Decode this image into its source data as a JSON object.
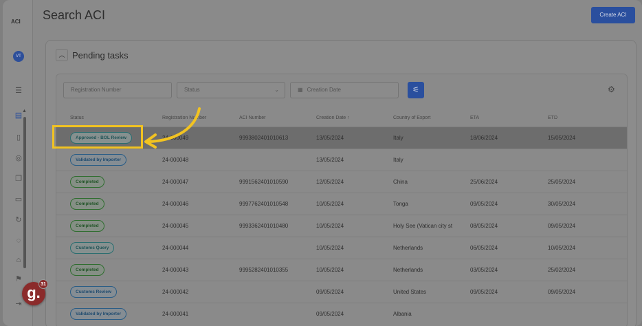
{
  "sidebar": {
    "logo": "ACI",
    "avatar_initials": "VT",
    "icons": [
      "filter-icon",
      "document-icon",
      "file-icon",
      "globe-icon",
      "copy-icon",
      "report-icon",
      "refresh-icon",
      "chat-icon",
      "user-icon",
      "flag-icon",
      "logout-icon"
    ]
  },
  "header": {
    "title": "Search ACI",
    "create_label": "Create ACI"
  },
  "panel": {
    "title": "Pending tasks"
  },
  "filters": {
    "registration_placeholder": "Registration Number",
    "status_placeholder": "Status",
    "creation_date_placeholder": "Creation Date"
  },
  "table": {
    "columns": [
      "Status",
      "Registration Number",
      "ACI Number",
      "Creation Date ↑",
      "Country of Export",
      "ETA",
      "ETD"
    ],
    "rows": [
      {
        "status": "Approved - BOL Review",
        "tone": "teal",
        "reg": "24-000049",
        "aci": "9993802401010613",
        "created": "13/05/2024",
        "country": "Italy",
        "eta": "18/06/2024",
        "etd": "15/05/2024"
      },
      {
        "status": "Validated by Importer",
        "tone": "blue",
        "reg": "24-000048",
        "aci": "",
        "created": "13/05/2024",
        "country": "Italy",
        "eta": "",
        "etd": ""
      },
      {
        "status": "Completed",
        "tone": "green",
        "reg": "24-000047",
        "aci": "9991562401010590",
        "created": "12/05/2024",
        "country": "China",
        "eta": "25/06/2024",
        "etd": "25/05/2024"
      },
      {
        "status": "Completed",
        "tone": "green",
        "reg": "24-000046",
        "aci": "9997762401010548",
        "created": "10/05/2024",
        "country": "Tonga",
        "eta": "09/05/2024",
        "etd": "30/05/2024"
      },
      {
        "status": "Completed",
        "tone": "green",
        "reg": "24-000045",
        "aci": "9993362401010480",
        "created": "10/05/2024",
        "country": "Holy See (Vatican city st",
        "eta": "08/05/2024",
        "etd": "09/05/2024"
      },
      {
        "status": "Customs Query",
        "tone": "teal",
        "reg": "24-000044",
        "aci": "",
        "created": "10/05/2024",
        "country": "Netherlands",
        "eta": "06/05/2024",
        "etd": "10/05/2024"
      },
      {
        "status": "Completed",
        "tone": "green",
        "reg": "24-000043",
        "aci": "9995282401010355",
        "created": "10/05/2024",
        "country": "Netherlands",
        "eta": "03/05/2024",
        "etd": "25/02/2024"
      },
      {
        "status": "Customs Review",
        "tone": "blue",
        "reg": "24-000042",
        "aci": "",
        "created": "09/05/2024",
        "country": "United States",
        "eta": "09/05/2024",
        "etd": "09/05/2024"
      },
      {
        "status": "Validated by Importer",
        "tone": "blue",
        "reg": "24-000041",
        "aci": "",
        "created": "09/05/2024",
        "country": "Albania",
        "eta": "",
        "etd": ""
      }
    ]
  },
  "guide_badge": {
    "letter": "g.",
    "count": "31"
  },
  "colors": {
    "accent": "#2a4f9e",
    "highlight": "#f2c321"
  }
}
